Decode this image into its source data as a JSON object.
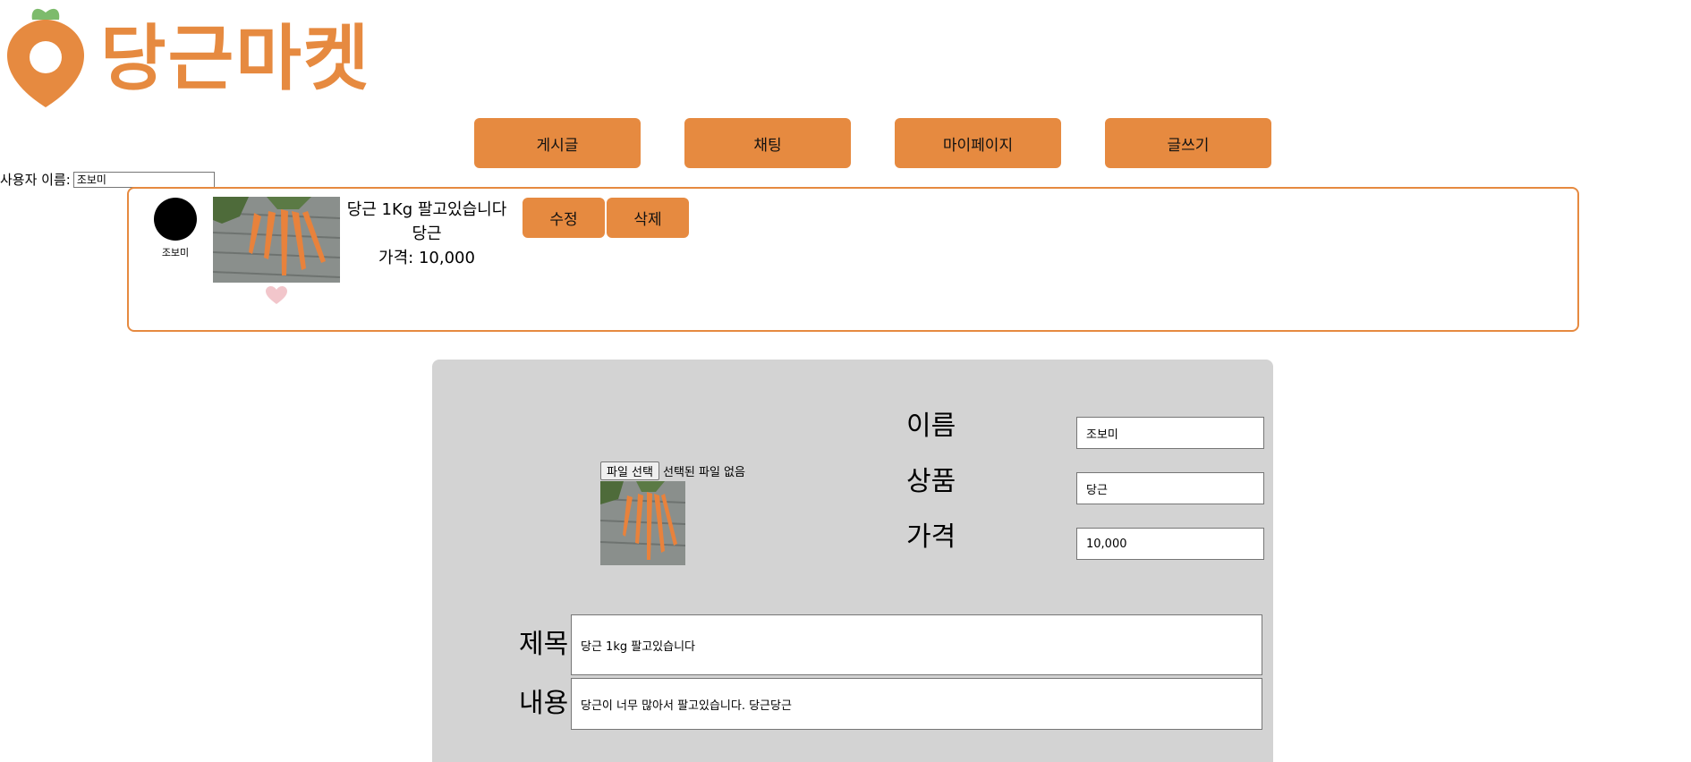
{
  "brand": {
    "name": "당근마켓",
    "color": "#E68A40",
    "leaf_color": "#7DBB6C",
    "logo_icon": "carrot-icon"
  },
  "nav": {
    "items": [
      {
        "label": "게시글"
      },
      {
        "label": "채팅"
      },
      {
        "label": "마이페이지"
      },
      {
        "label": "글쓰기"
      }
    ]
  },
  "user": {
    "label": "사용자 이름:",
    "value": "조보미"
  },
  "post": {
    "author": "조보미",
    "title": "당근 1Kg 팔고있습니다",
    "product": "당근",
    "price_text": "가격: 10,000",
    "like_icon": "heart-icon",
    "edit_label": "수정",
    "delete_label": "삭제"
  },
  "form": {
    "file_button": "파일 선택",
    "file_status": "선택된 파일 없음",
    "name_label": "이름",
    "name_value": "조보미",
    "product_label": "상품",
    "product_value": "당근",
    "price_label": "가격",
    "price_value": "10,000",
    "title_label": "제목",
    "title_value": "당근 1kg 팔고있습니다",
    "content_label": "내용",
    "content_value": "당근이 너무 많아서 팔고있습니다. 당근당근"
  }
}
